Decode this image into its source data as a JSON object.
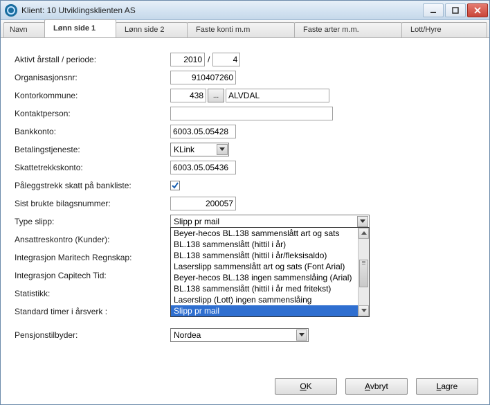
{
  "window": {
    "title": "Klient:  10  Utviklingsklienten AS"
  },
  "tabs": {
    "t0": "Navn",
    "t1": "Lønn side 1",
    "t2": "Lønn side 2",
    "t3": "Faste konti m.m",
    "t4": "Faste arter m.m.",
    "t5": "Lott/Hyre"
  },
  "labels": {
    "aktivt": "Aktivt årstall / periode:",
    "orgnr": "Organisasjonsnr:",
    "kontorkommune": "Kontorkommune:",
    "kontaktperson": "Kontaktperson:",
    "bankkonto": "Bankkonto:",
    "betaling": "Betalingstjeneste:",
    "skattetrekk": "Skattetrekkskonto:",
    "palegg": "Påleggstrekk skatt på bankliste:",
    "sistbrukte": "Sist brukte bilagsnummer:",
    "typeslipp": "Type slipp:",
    "ansattres": "Ansattreskontro (Kunder):",
    "integrMaritech": "Integrasjon Maritech Regnskap:",
    "integrCapitech": "Integrasjon Capitech Tid:",
    "statistikk": "Statistikk:",
    "stdtimer": "Standard timer i årsverk :",
    "pensjon": "Pensjonstilbyder:"
  },
  "values": {
    "year": "2010",
    "period": "4",
    "orgnr": "910407260",
    "kommunenr": "438",
    "kommunenavn": "ALVDAL",
    "kontaktperson": "",
    "bankkonto": "6003.05.05428",
    "betaling": "KLink",
    "skattetrekk": "6003.05.05436",
    "sistbrukte": "200057",
    "typeslipp": "Slipp pr mail",
    "pensjon": "Nordea",
    "palegg_checked": true
  },
  "dropdown": {
    "i0": "Beyer-hecos BL.138 sammenslått art og sats",
    "i1": "BL.138 sammenslått (hittil i år)",
    "i2": "BL.138 sammenslått (hittil i år/fleksisaldo)",
    "i3": "Laserslipp sammenslått art og sats (Font Arial)",
    "i4": "Beyer-hecos BL.138 ingen sammenslåing (Arial)",
    "i5": "BL.138 sammenslått (hittil i år med fritekst)",
    "i6": "Laserslipp (Lott) ingen sammenslåing",
    "i7": "Slipp pr mail"
  },
  "buttons": {
    "ok": "OK",
    "avbryt": "Avbryt",
    "lagre": "Lagre",
    "lookup": "..."
  }
}
